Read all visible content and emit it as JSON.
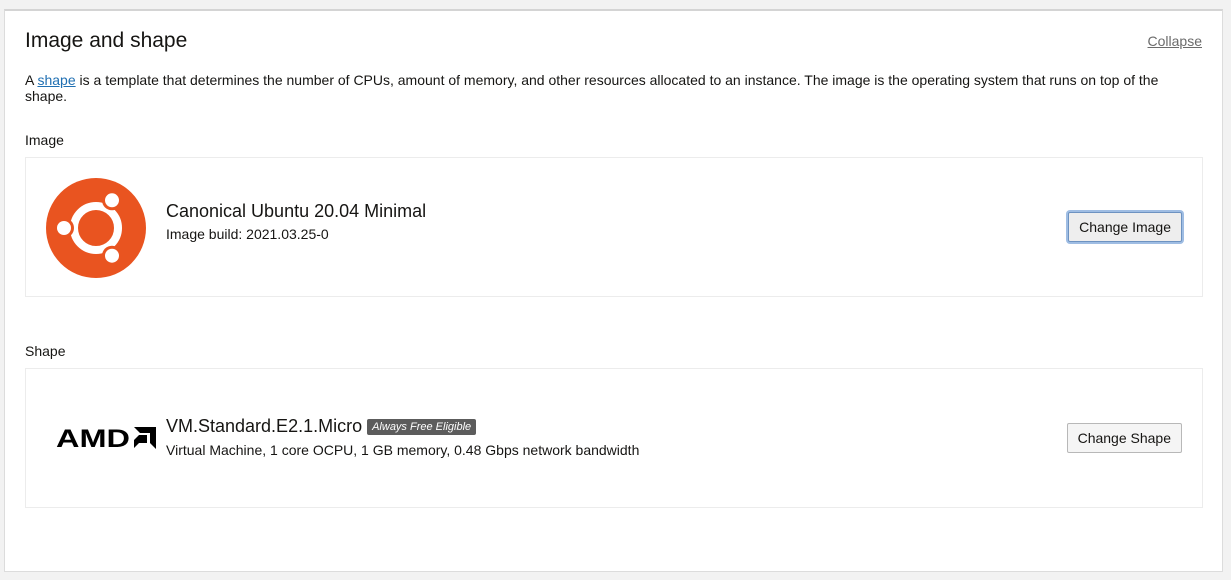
{
  "section": {
    "title": "Image and shape",
    "collapse_label": "Collapse",
    "description_prefix": "A ",
    "description_link": "shape",
    "description_suffix": " is a template that determines the number of CPUs, amount of memory, and other resources allocated to an instance. The image is the operating system that runs on top of the shape."
  },
  "image": {
    "label": "Image",
    "name": "Canonical Ubuntu 20.04 Minimal",
    "build": "Image build: 2021.03.25-0",
    "button_label": "Change Image",
    "logo_icon": "ubuntu-logo",
    "logo_color": "#e95420"
  },
  "shape": {
    "label": "Shape",
    "name": "VM.Standard.E2.1.Micro",
    "badge": "Always Free Eligible",
    "details": "Virtual Machine, 1 core OCPU, 1 GB memory, 0.48 Gbps network bandwidth",
    "button_label": "Change Shape",
    "logo_text": "AMD",
    "logo_color": "#000000"
  }
}
